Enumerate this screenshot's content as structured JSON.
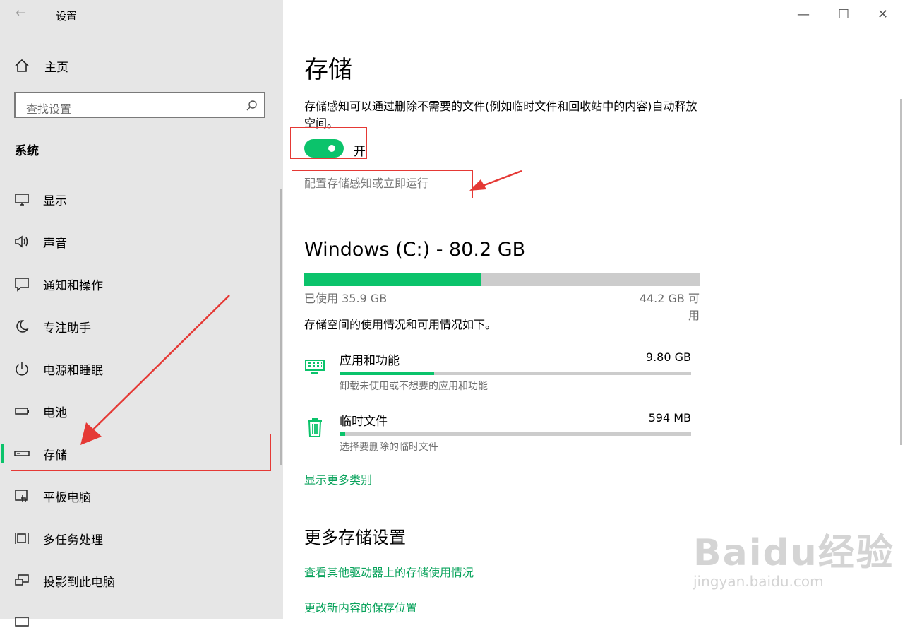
{
  "window": {
    "title": "设置",
    "back_glyph": "←",
    "minimize_glyph": "—",
    "maximize_glyph": "☐",
    "close_glyph": "✕"
  },
  "sidebar": {
    "home_label": "主页",
    "search_placeholder": "查找设置",
    "section_label": "系统",
    "items": [
      {
        "label": "显示",
        "icon": "display-icon"
      },
      {
        "label": "声音",
        "icon": "speaker-icon"
      },
      {
        "label": "通知和操作",
        "icon": "notification-icon"
      },
      {
        "label": "专注助手",
        "icon": "moon-icon"
      },
      {
        "label": "电源和睡眠",
        "icon": "power-icon"
      },
      {
        "label": "电池",
        "icon": "battery-icon"
      },
      {
        "label": "存储",
        "icon": "storage-icon",
        "active": true
      },
      {
        "label": "平板电脑",
        "icon": "tablet-icon"
      },
      {
        "label": "多任务处理",
        "icon": "multitask-icon"
      },
      {
        "label": "投影到此电脑",
        "icon": "project-icon"
      }
    ]
  },
  "main": {
    "title": "存储",
    "description": "存储感知可以通过删除不需要的文件(例如临时文件和回收站中的内容)自动释放空间。",
    "toggle_state": "开",
    "toggle_on": true,
    "configure_link": "配置存储感知或立即运行",
    "drive": {
      "title": "Windows (C:) - 80.2 GB",
      "used_label": "已使用 35.9 GB",
      "available_label": "44.2 GB 可用",
      "used_fraction": 0.448
    },
    "usage_intro": "存储空间的使用情况和可用情况如下。",
    "categories": [
      {
        "name": "应用和功能",
        "size": "9.80 GB",
        "sub": "卸载未使用或不想要的应用和功能",
        "fraction": 0.27,
        "icon": "apps-icon"
      },
      {
        "name": "临时文件",
        "size": "594 MB",
        "sub": "选择要删除的临时文件",
        "fraction": 0.016,
        "icon": "trash-icon"
      }
    ],
    "show_more_link": "显示更多类别",
    "more_settings_title": "更多存储设置",
    "more_links": [
      "查看其他驱动器上的存储使用情况",
      "更改新内容的保存位置"
    ]
  },
  "colors": {
    "accent": "#0bc36b",
    "link": "#0aa35c",
    "annotation": "#e53935"
  },
  "watermark": {
    "brand": "Baidu经验",
    "url": "jingyan.baidu.com"
  }
}
